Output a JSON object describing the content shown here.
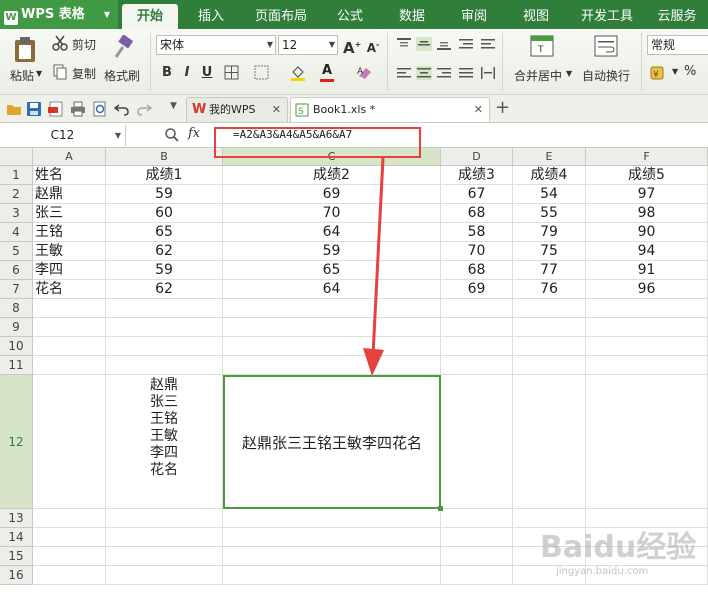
{
  "app": {
    "name": "WPS 表格"
  },
  "menu": {
    "tabs": [
      "开始",
      "插入",
      "页面布局",
      "公式",
      "数据",
      "审阅",
      "视图",
      "开发工具",
      "云服务"
    ]
  },
  "ribbon": {
    "paste": "粘贴",
    "cut": "剪切",
    "copy": "复制",
    "format_painter": "格式刷",
    "font_name": "宋体",
    "font_size": "12",
    "merge_center": "合并居中",
    "wrap_text": "自动换行",
    "number_format": "常规",
    "percent": "%"
  },
  "doc_tabs": [
    {
      "label": "我的WPS"
    },
    {
      "label": "Book1.xls *"
    }
  ],
  "formula_bar": {
    "name_box": "C12",
    "fx": "fx",
    "formula": "=A2&A3&A4&A5&A6&A7"
  },
  "sheet": {
    "columns": [
      "A",
      "B",
      "C",
      "D",
      "E",
      "F"
    ],
    "rows": [
      "1",
      "2",
      "3",
      "4",
      "5",
      "6",
      "7",
      "8",
      "9",
      "10",
      "11",
      "12",
      "13",
      "14",
      "15",
      "16"
    ],
    "data": [
      [
        "姓名",
        "成绩1",
        "成绩2",
        "成绩3",
        "成绩4",
        "成绩5"
      ],
      [
        "赵鼎",
        "59",
        "69",
        "67",
        "54",
        "97"
      ],
      [
        "张三",
        "60",
        "70",
        "68",
        "55",
        "98"
      ],
      [
        "王铭",
        "65",
        "64",
        "58",
        "79",
        "90"
      ],
      [
        "王敏",
        "62",
        "59",
        "70",
        "75",
        "94"
      ],
      [
        "李四",
        "59",
        "65",
        "68",
        "77",
        "91"
      ],
      [
        "花名",
        "62",
        "64",
        "69",
        "76",
        "96"
      ]
    ],
    "b12_lines": "赵鼎\n张三\n王铭\n王敏\n李四\n花名",
    "c12_value": "赵鼎张三王铭王敏李四花名"
  },
  "watermark": {
    "text": "Baidu经验",
    "url": "jingyan.baidu.com"
  },
  "colors": {
    "accent": "#2f7e3a",
    "highlight": "#e5413d",
    "selection": "#4b9a3c"
  }
}
